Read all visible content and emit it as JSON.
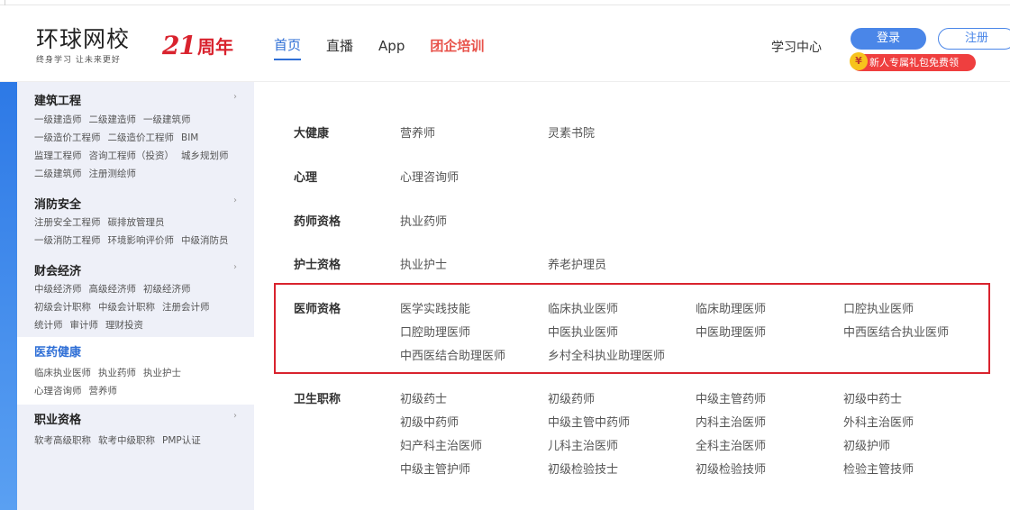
{
  "logo": {
    "main": "环球网校",
    "sub": "终身学习 让未来更好"
  },
  "anniversary": {
    "num": "21",
    "label": "周年"
  },
  "nav": {
    "items": [
      "首页",
      "直播",
      "App",
      "团企培训"
    ]
  },
  "header_right": {
    "study": "学习中心",
    "login": "登录",
    "register": "注册",
    "gift": "新人专属礼包免费领",
    "yen": "¥"
  },
  "sidebar": {
    "categories": [
      {
        "title": "建筑工程",
        "arrow": "›",
        "lines": [
          [
            "一级建造师",
            "二级建造师",
            "一级建筑师"
          ],
          [
            "一级造价工程师",
            "二级造价工程师",
            "BIM"
          ],
          [
            "监理工程师",
            "咨询工程师（投资）",
            "城乡规划师"
          ],
          [
            "二级建筑师",
            "注册测绘师"
          ]
        ]
      },
      {
        "title": "消防安全",
        "arrow": "›",
        "lines": [
          [
            "注册安全工程师",
            "碳排放管理员"
          ],
          [
            "一级消防工程师",
            "环境影响评价师",
            "中级消防员"
          ]
        ]
      },
      {
        "title": "财会经济",
        "arrow": "›",
        "lines": [
          [
            "中级经济师",
            "高级经济师",
            "初级经济师"
          ],
          [
            "初级会计职称",
            "中级会计职称",
            "注册会计师"
          ],
          [
            "统计师",
            "审计师",
            "理财投资"
          ]
        ]
      },
      {
        "title": "医药健康",
        "arrow": "",
        "lines": [
          [
            "临床执业医师",
            "执业药师",
            "执业护士"
          ],
          [
            "心理咨询师",
            "营养师"
          ]
        ]
      },
      {
        "title": "职业资格",
        "arrow": "›",
        "lines": [
          [
            "软考高级职称",
            "软考中级职称",
            "PMP认证"
          ]
        ]
      }
    ]
  },
  "panel": {
    "rows": [
      {
        "label": "大健康",
        "items": [
          "营养师",
          "灵素书院"
        ]
      },
      {
        "label": "心理",
        "items": [
          "心理咨询师"
        ]
      },
      {
        "label": "药师资格",
        "items": [
          "执业药师"
        ]
      },
      {
        "label": "护士资格",
        "items": [
          "执业护士",
          "养老护理员"
        ]
      },
      {
        "label": "医师资格",
        "items": [
          "医学实践技能",
          "临床执业医师",
          "临床助理医师",
          "口腔执业医师",
          "口腔助理医师",
          "中医执业医师",
          "中医助理医师",
          "中西医结合执业医师",
          "中西医结合助理医师",
          "乡村全科执业助理医师"
        ]
      },
      {
        "label": "卫生职称",
        "items": [
          "初级药士",
          "初级药师",
          "中级主管药师",
          "初级中药士",
          "初级中药师",
          "中级主管中药师",
          "内科主治医师",
          "外科主治医师",
          "妇产科主治医师",
          "儿科主治医师",
          "全科主治医师",
          "初级护师",
          "中级主管护师",
          "初级检验技士",
          "初级检验技师",
          "检验主管技师"
        ]
      }
    ]
  },
  "colors": {
    "brand_red": "#d9232e",
    "brand_blue": "#2f6fd6",
    "sidebar_bg": "#eef0f8"
  }
}
